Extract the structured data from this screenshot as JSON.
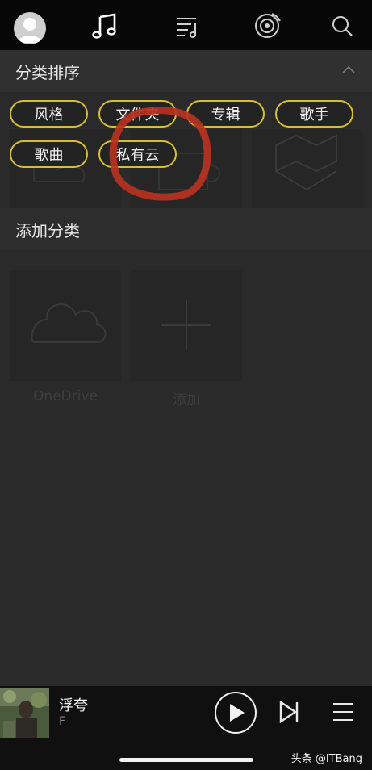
{
  "nav": {
    "tabs": [
      "avatar",
      "music-note",
      "playlist",
      "radio",
      "search"
    ]
  },
  "sort_section": {
    "title": "分类排序",
    "chips": [
      "风格",
      "文件夹",
      "专辑",
      "歌手",
      "歌曲",
      "私有云"
    ]
  },
  "add_section": {
    "title": "添加分类",
    "tiles": [
      {
        "label": "OneDrive",
        "icon": "cloud-icon"
      },
      {
        "label": "添加",
        "icon": "plus-icon"
      }
    ]
  },
  "player": {
    "title": "浮夸",
    "artist": "F"
  },
  "watermark": "头条 @ITBang",
  "colors": {
    "accent": "#d9be2f",
    "annotation": "#b8321f",
    "background": "#2a2a2a",
    "topbar": "#070707"
  }
}
